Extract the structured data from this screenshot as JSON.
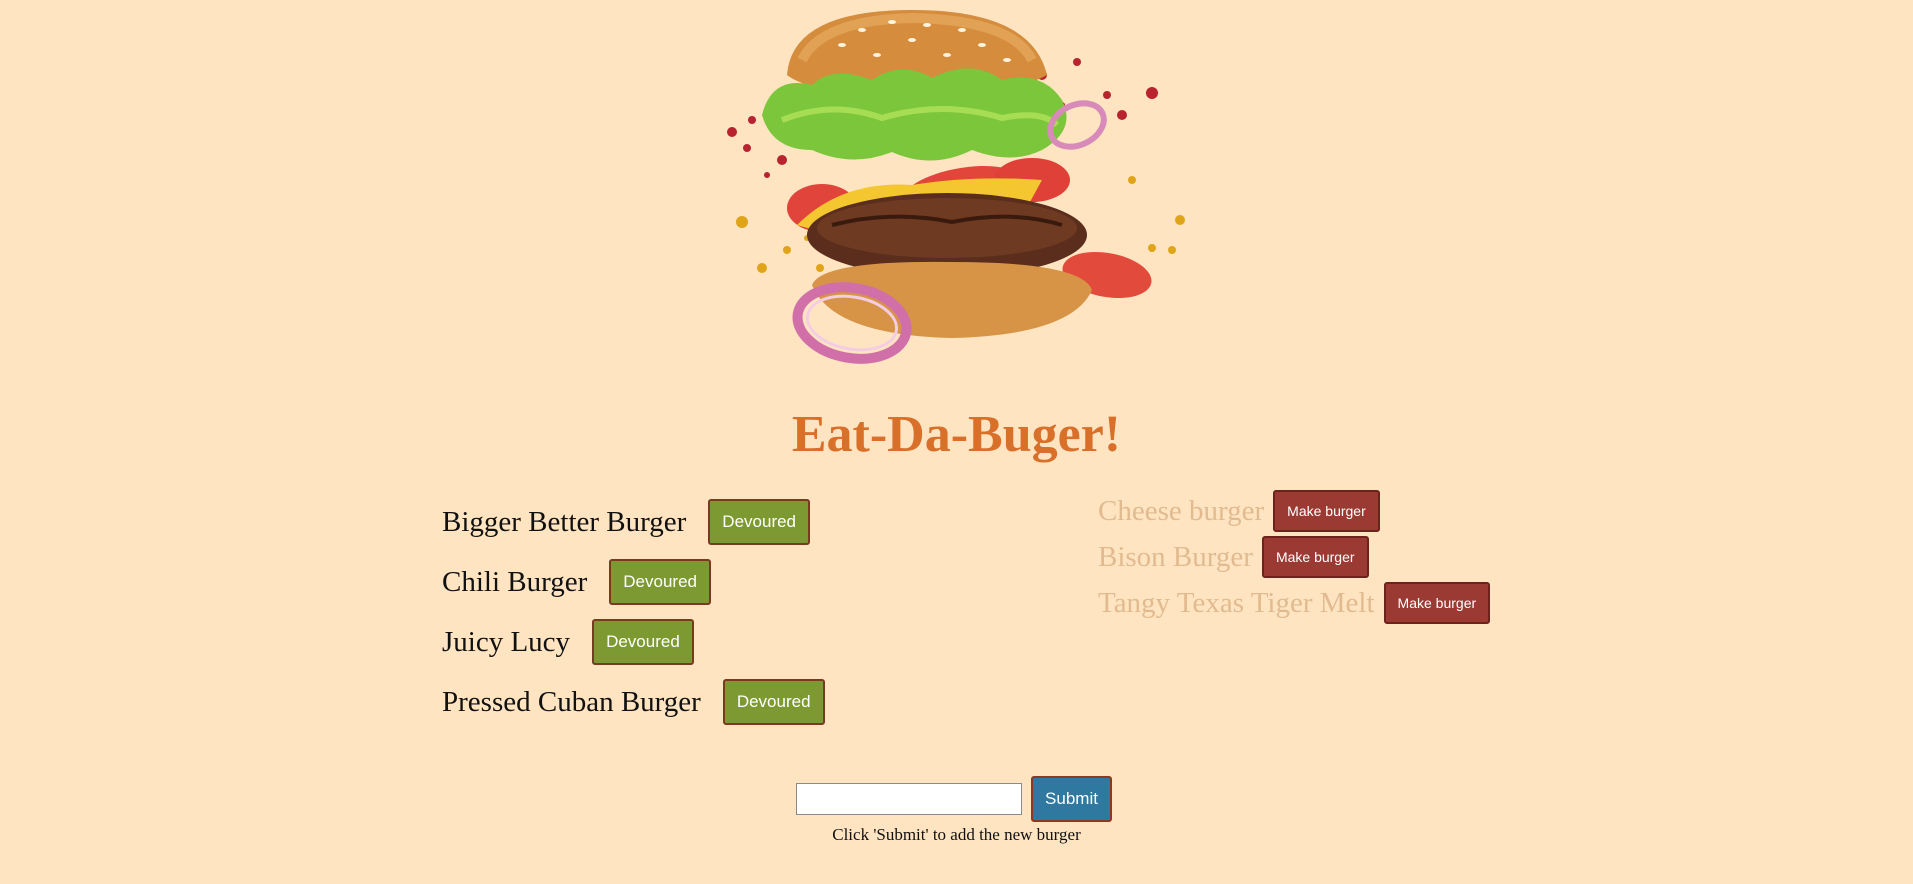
{
  "hero": {
    "image": "flying-burger-illustration"
  },
  "title": "Eat-Da-Buger!",
  "devoured": [
    {
      "name": "Bigger Better Burger",
      "button": "Devoured"
    },
    {
      "name": "Chili Burger",
      "button": "Devoured"
    },
    {
      "name": "Juicy Lucy",
      "button": "Devoured"
    },
    {
      "name": "Pressed Cuban Burger",
      "button": "Devoured"
    }
  ],
  "to_make": [
    {
      "name": "Cheese burger",
      "button": "Make burger"
    },
    {
      "name": "Bison Burger",
      "button": "Make burger"
    },
    {
      "name": "Tangy Texas Tiger Melt",
      "button": "Make burger"
    }
  ],
  "form": {
    "input_value": "",
    "input_placeholder": "",
    "submit_label": "Submit",
    "hint": "Click 'Submit' to add the new burger"
  },
  "colors": {
    "background": "#ffe4c2",
    "title": "#d9702a",
    "devoured_button": "#7d9a32",
    "make_button": "#9a3a33",
    "submit_button": "#2f78a0",
    "pending_text": "#e1bb8f"
  }
}
